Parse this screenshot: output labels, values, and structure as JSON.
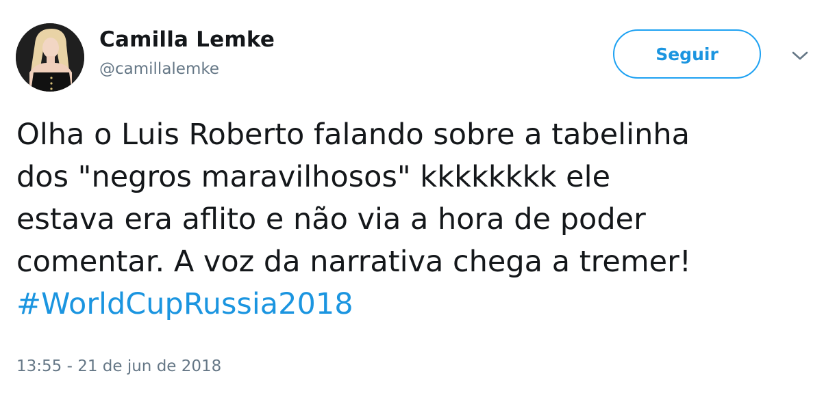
{
  "tweet": {
    "author": {
      "display_name": "Camilla Lemke",
      "handle": "@camillalemke"
    },
    "follow_button_label": "Seguir",
    "menu_icon": "chevron-down-icon",
    "text_lines": [
      "Olha o Luis Roberto falando sobre a tabelinha",
      "dos \"negros maravilhosos\" kkkkkkkk ele",
      "estava era aflito e não via a hora de poder",
      "comentar. A voz da narrativa chega a tremer!"
    ],
    "hashtag": "#WorldCupRussia2018",
    "timestamp": "13:55 - 21 de jun de 2018"
  },
  "colors": {
    "text": "#14171a",
    "secondary": "#657786",
    "accent": "#1da1f2",
    "link": "#1b95e0"
  }
}
